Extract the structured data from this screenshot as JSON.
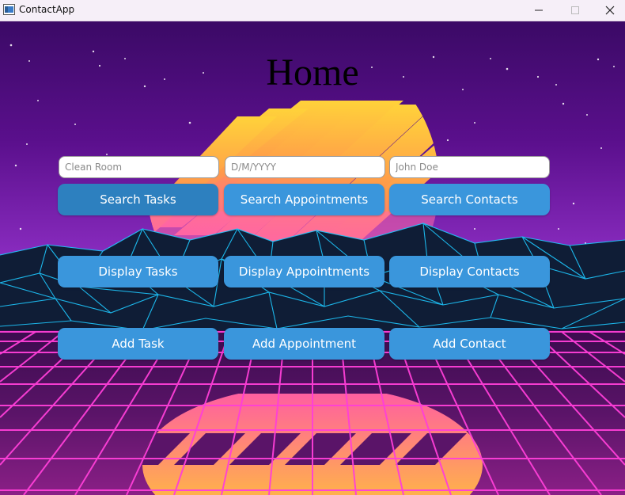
{
  "window": {
    "title": "ContactApp"
  },
  "page": {
    "title": "Home"
  },
  "search": {
    "task_placeholder": "Clean Room",
    "date_placeholder": "D/M/YYYY",
    "contact_placeholder": "John Doe"
  },
  "buttons": {
    "search_tasks": "Search Tasks",
    "search_appointments": "Search Appointments",
    "search_contacts": "Search Contacts",
    "display_tasks": "Display Tasks",
    "display_appointments": "Display Appointments",
    "display_contacts": "Display Contacts",
    "add_task": "Add Task",
    "add_appointment": "Add Appointment",
    "add_contact": "Add Contact"
  },
  "colors": {
    "button": "#3a96dc",
    "button_active": "#2d80bf",
    "sky_top": "#4a0a73",
    "grid_line": "#ff3fd8",
    "mountain_line": "#1ec8ff"
  }
}
